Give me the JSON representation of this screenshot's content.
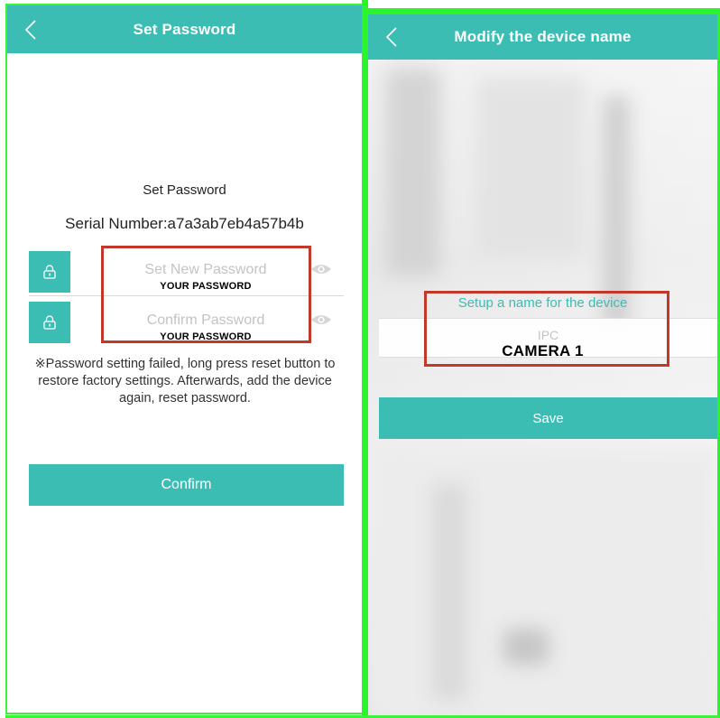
{
  "colors": {
    "accent": "#3bbdb4",
    "frame_green": "#2bf42a",
    "annotation_red": "#c0392b"
  },
  "left_screen": {
    "nav": {
      "back_icon": "chevron-left-icon",
      "title": "Set Password"
    },
    "heading": "Set Password",
    "serial": "Serial Number:a7a3ab7eb4a57b4b",
    "new_password": {
      "icon": "lock-icon",
      "placeholder": "Set New Password",
      "overlay": "YOUR PASSWORD",
      "toggle_icon": "eye-icon"
    },
    "confirm_password": {
      "icon": "lock-icon",
      "placeholder": "Confirm Password",
      "overlay": "YOUR PASSWORD",
      "toggle_icon": "eye-icon"
    },
    "note": "※Password setting failed, long press reset button to restore factory settings. Afterwards, add the device again, reset password.",
    "confirm_button": "Confirm"
  },
  "right_screen": {
    "nav": {
      "back_icon": "chevron-left-icon",
      "title": "Modify the device name"
    },
    "field_label": "Setup a name for the device",
    "name_input": {
      "placeholder": "IPC",
      "overlay": "CAMERA 1"
    },
    "save_button": "Save"
  }
}
